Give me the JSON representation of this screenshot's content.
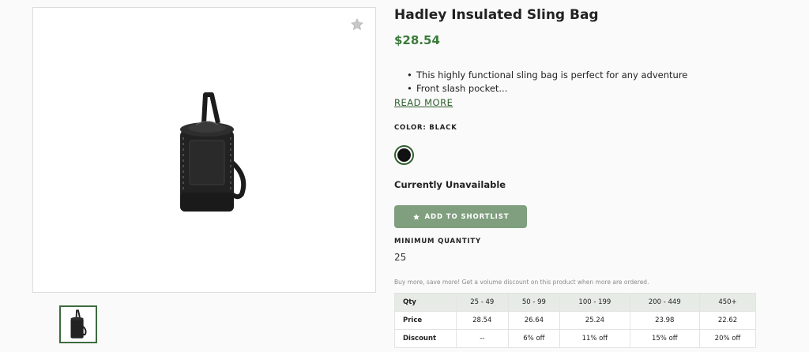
{
  "product": {
    "title": "Hadley Insulated Sling Bag",
    "price": "$28.54",
    "description": [
      "This highly functional sling bag is perfect for any adventure",
      "Front slash pocket..."
    ],
    "read_more": "READ MORE",
    "color_label": "COLOR: BLACK",
    "colors": [
      {
        "name": "Black",
        "hex": "#111111",
        "selected": true
      }
    ],
    "availability": "Currently Unavailable",
    "shortlist_button": "ADD TO SHORTLIST",
    "min_qty_label": "MINIMUM QUANTITY",
    "min_qty": "25",
    "volume_note": "Buy more, save more! Get a volume discount on this product when more are ordered."
  },
  "pricing_table": {
    "header": [
      "Qty",
      "25 - 49",
      "50 - 99",
      "100 - 199",
      "200 - 449",
      "450+"
    ],
    "rows": [
      [
        "Price",
        "28.54",
        "26.64",
        "25.24",
        "23.98",
        "22.62"
      ],
      [
        "Discount",
        "--",
        "6% off",
        "11% off",
        "15% off",
        "20% off"
      ]
    ]
  },
  "icons": {
    "favorite": "star-icon",
    "shortlist": "star-icon"
  },
  "colors": {
    "accent_green": "#3a7a3a",
    "button_green": "#7f9f7f",
    "table_header_bg": "#e6ebe6"
  }
}
